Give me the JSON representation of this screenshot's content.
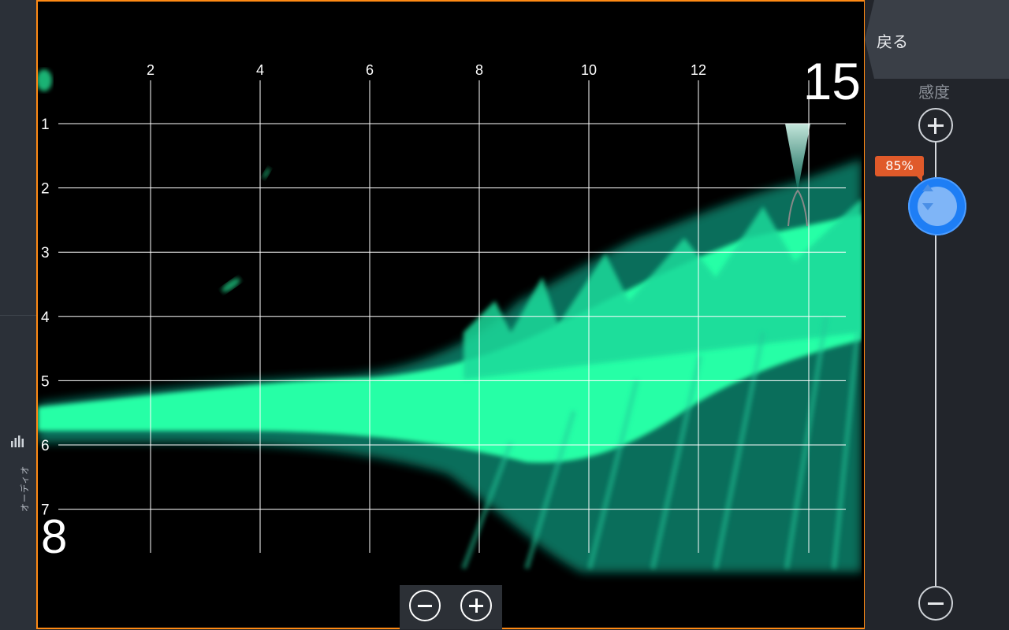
{
  "sidebar": {
    "audio_label": "オーディオ",
    "audio_icon": "audio-bars-icon"
  },
  "sonar": {
    "range_start": "8",
    "range_end": "15",
    "x_ticks": [
      "2",
      "4",
      "6",
      "8",
      "10",
      "12"
    ],
    "y_ticks": [
      "1",
      "2",
      "3",
      "4",
      "5",
      "6",
      "7"
    ],
    "colors": {
      "echo": "#26ffa6",
      "frame": "#ff8a14",
      "grid": "#ffffff"
    }
  },
  "zoom": {
    "out_icon": "minus-circle-icon",
    "in_icon": "plus-circle-icon"
  },
  "panel": {
    "back_label": "戻る",
    "gain_label": "感度",
    "gain_value": "85%",
    "gain_fraction": 0.85
  }
}
